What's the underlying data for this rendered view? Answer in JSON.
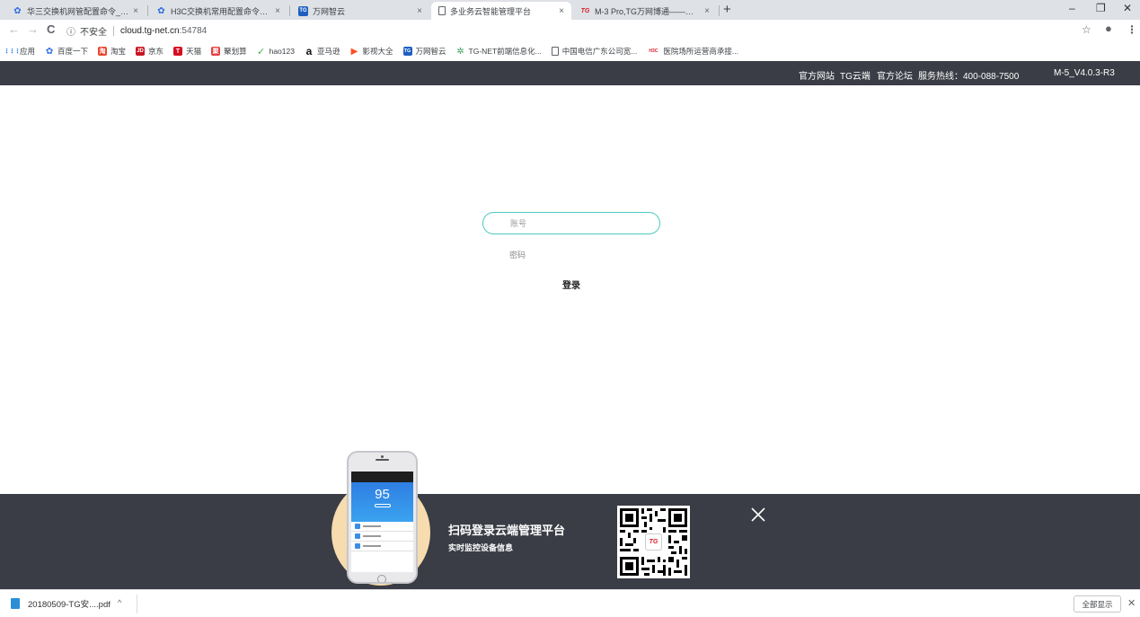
{
  "browser": {
    "tabs": [
      {
        "title": "华三交换机网管配置命令_百度搜",
        "icon": "baidu-paw",
        "color": "#2f6de0"
      },
      {
        "title": "H3C交换机常用配置命令大全.do",
        "icon": "baidu-paw",
        "color": "#2f6de0"
      },
      {
        "title": "万网智云",
        "icon": "tg-logo",
        "color": "#1f5fc0"
      },
      {
        "title": "多业务云智能管理平台",
        "icon": "page-icon",
        "color": "#ffffff"
      },
      {
        "title": "M-3 Pro,TG万网博通——专注于",
        "icon": "tg-logo",
        "color": "#d81e2a"
      }
    ],
    "active_tab_index": 3,
    "tab_close_glyph": "×",
    "new_tab_glyph": "+",
    "window_controls": {
      "minimize": "–",
      "restore": "❐",
      "close": "✕"
    },
    "nav": {
      "back": "←",
      "forward": "→",
      "reload": "C"
    },
    "address": {
      "security_icon": "ⓘ",
      "security_label": "不安全",
      "url_host": "cloud.tg-net.cn",
      "url_port": ":54784"
    },
    "toolbar_right": {
      "star": "☆",
      "profile": "●",
      "menu": "⋮"
    },
    "bookmarks": [
      {
        "label": "应用",
        "icon": "apps-grid",
        "color": "#1a73e8",
        "glyph": "⋮⋮⋮"
      },
      {
        "label": "百度一下",
        "icon": "baidu-paw",
        "color": "#2f6de0",
        "glyph": "✿"
      },
      {
        "label": "淘宝",
        "icon": "taobao",
        "color": "#e8452e",
        "glyph": "淘"
      },
      {
        "label": "京东",
        "icon": "jd",
        "color": "#c81623",
        "glyph": "JD"
      },
      {
        "label": "天猫",
        "icon": "tmall",
        "color": "#d60d1f",
        "glyph": "T"
      },
      {
        "label": "聚划算",
        "icon": "juhuasuan",
        "color": "#e33c3c",
        "glyph": "聚"
      },
      {
        "label": "hao123",
        "icon": "hao123",
        "color": "#4caf50",
        "glyph": "✓"
      },
      {
        "label": "亚马逊",
        "icon": "amazon",
        "color": "#111111",
        "glyph": "a"
      },
      {
        "label": "影视大全",
        "icon": "video",
        "color": "#ff4c1f",
        "glyph": "▶"
      },
      {
        "label": "万网智云",
        "icon": "tg-logo",
        "color": "#1f5fc0",
        "glyph": "TG"
      },
      {
        "label": "TG-NET前端信息化...",
        "icon": "gear",
        "color": "#3aa05a",
        "glyph": "✲"
      },
      {
        "label": "中国电信广东公司宽...",
        "icon": "page-icon",
        "color": "#ffffff",
        "glyph": "▯"
      },
      {
        "label": "医院场所运营商承接...",
        "icon": "h3c",
        "color": "#d81e2a",
        "glyph": "H3C"
      }
    ]
  },
  "site": {
    "header_links": [
      "官方网站",
      "TG云端",
      "官方论坛",
      "服务热线：400-088-7500"
    ],
    "version": "M-5_V4.0.3-R3",
    "colors": {
      "header_bg": "#3a3d45",
      "accent": "#4cc9c4"
    }
  },
  "login": {
    "username_placeholder": "账号",
    "password_placeholder": "密码",
    "submit_label": "登录"
  },
  "promo": {
    "title": "扫码登录云端管理平台",
    "subtitle": "实时监控设备信息",
    "phone_score": "95",
    "close_glyph": "✕",
    "qr_logo": "TG"
  },
  "downloads": {
    "file_name": "20180509-TG安....pdf",
    "chevron": "^",
    "show_all_label": "全部显示",
    "close_glyph": "✕"
  }
}
